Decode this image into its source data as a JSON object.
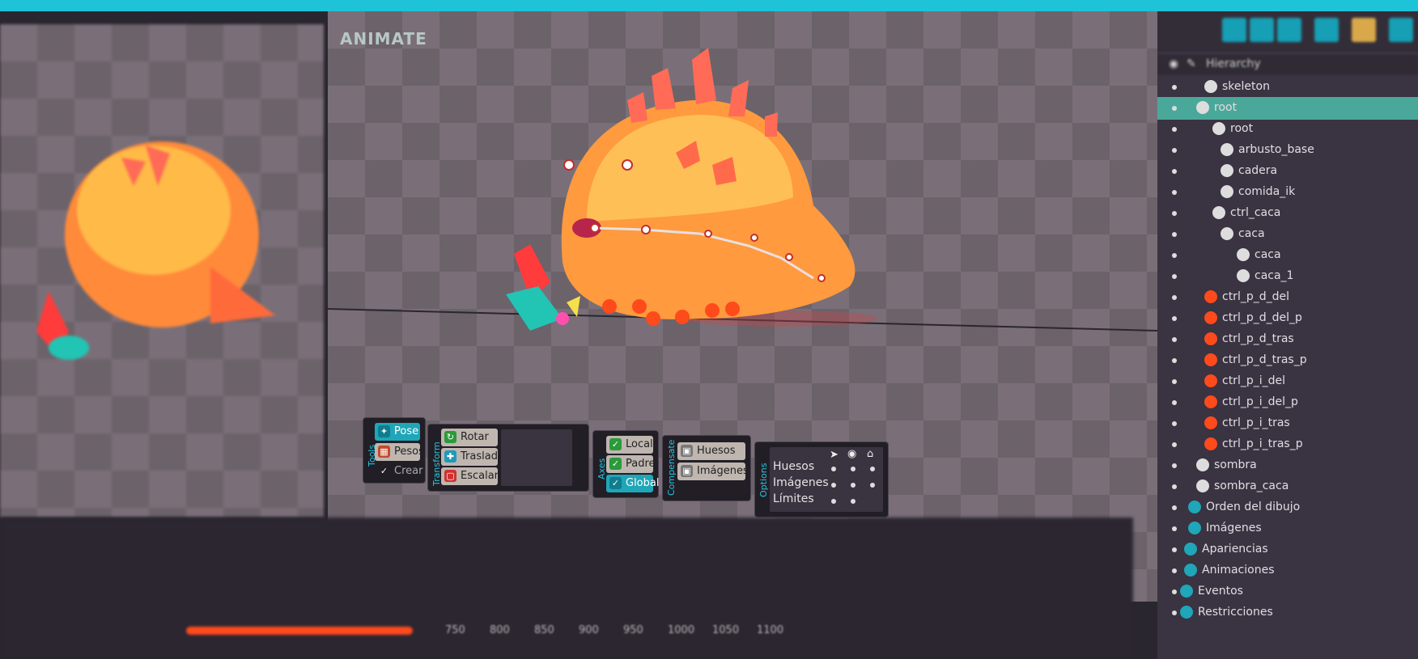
{
  "app_logo": "ANIMATE",
  "tools": {
    "title": "Tools",
    "pose": "Pose",
    "pesos": "Pesos",
    "crear": "Crear"
  },
  "transform": {
    "title": "Transform",
    "rotar": "Rotar",
    "trasladar": "Trasladar",
    "escalar": "Escalar"
  },
  "axes": {
    "title": "Axes",
    "local": "Local",
    "padre": "Padre",
    "global": "Global"
  },
  "compensate": {
    "title": "Compensate",
    "huesos": "Huesos",
    "imagenes": "Imágenes"
  },
  "options": {
    "title": "Options",
    "rows": [
      "Huesos",
      "Imágenes",
      "Límites"
    ]
  },
  "hierarchy": {
    "title": "Hierarchy",
    "items": [
      {
        "label": "skeleton"
      },
      {
        "label": "root"
      },
      {
        "label": "root"
      },
      {
        "label": "arbusto_base"
      },
      {
        "label": "cadera"
      },
      {
        "label": "comida_ik"
      },
      {
        "label": "ctrl_caca"
      },
      {
        "label": "caca"
      },
      {
        "label": "caca"
      },
      {
        "label": "caca_1"
      },
      {
        "label": "ctrl_p_d_del"
      },
      {
        "label": "ctrl_p_d_del_p"
      },
      {
        "label": "ctrl_p_d_tras"
      },
      {
        "label": "ctrl_p_d_tras_p"
      },
      {
        "label": "ctrl_p_i_del"
      },
      {
        "label": "ctrl_p_i_del_p"
      },
      {
        "label": "ctrl_p_i_tras"
      },
      {
        "label": "ctrl_p_i_tras_p"
      },
      {
        "label": "sombra"
      },
      {
        "label": "sombra_caca"
      },
      {
        "label": "Orden del dibujo"
      },
      {
        "label": "Imágenes"
      },
      {
        "label": "Apariencias"
      },
      {
        "label": "Animaciones"
      },
      {
        "label": "Eventos"
      },
      {
        "label": "Restricciones"
      }
    ]
  },
  "timeline": {
    "ticks": [
      "750",
      "800",
      "850",
      "900",
      "950",
      "1000",
      "1050",
      "1100"
    ]
  },
  "colors": {
    "accent": "#1ec3d8",
    "selection": "#4aa89a",
    "control": "#ff4a1c"
  }
}
